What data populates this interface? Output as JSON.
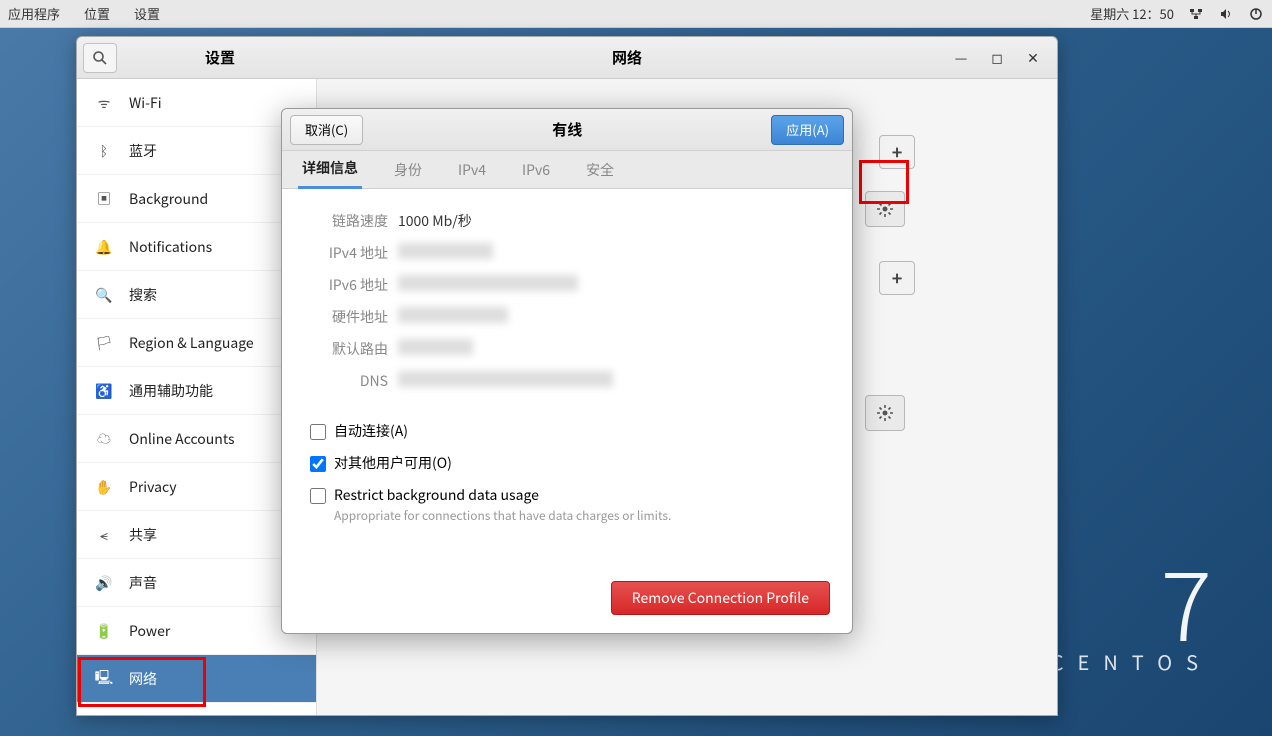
{
  "top_panel": {
    "apps": "应用程序",
    "places": "位置",
    "settings": "设置",
    "datetime": "星期六 12：50"
  },
  "brand": {
    "seven": "7",
    "name": "CENTOS"
  },
  "settings_window": {
    "search_title": "设置",
    "page_title": "网络",
    "sidebar": [
      {
        "icon": "wifi",
        "label": "Wi-Fi"
      },
      {
        "icon": "bluetooth",
        "label": "蓝牙"
      },
      {
        "icon": "background",
        "label": "Background"
      },
      {
        "icon": "bell",
        "label": "Notifications"
      },
      {
        "icon": "search",
        "label": "搜索"
      },
      {
        "icon": "region",
        "label": "Region & Language"
      },
      {
        "icon": "accessibility",
        "label": "通用辅助功能"
      },
      {
        "icon": "online",
        "label": "Online Accounts"
      },
      {
        "icon": "privacy",
        "label": "Privacy"
      },
      {
        "icon": "share",
        "label": "共享"
      },
      {
        "icon": "sound",
        "label": "声音"
      },
      {
        "icon": "power",
        "label": "Power"
      },
      {
        "icon": "network",
        "label": "网络"
      }
    ]
  },
  "dialog": {
    "cancel": "取消(C)",
    "apply": "应用(A)",
    "title": "有线",
    "tabs": [
      "详细信息",
      "身份",
      "IPv4",
      "IPv6",
      "安全"
    ],
    "details": {
      "link_speed_label": "链路速度",
      "link_speed_value": "1000 Mb/秒",
      "ipv4_label": "IPv4 地址",
      "ipv6_label": "IPv6 地址",
      "hw_label": "硬件地址",
      "route_label": "默认路由",
      "dns_label": "DNS"
    },
    "auto_connect": "自动连接(A)",
    "available_others": "对其他用户可用(O)",
    "restrict_bg": "Restrict background data usage",
    "restrict_bg_sub": "Appropriate for connections that have data charges or limits.",
    "remove": "Remove Connection Profile"
  }
}
